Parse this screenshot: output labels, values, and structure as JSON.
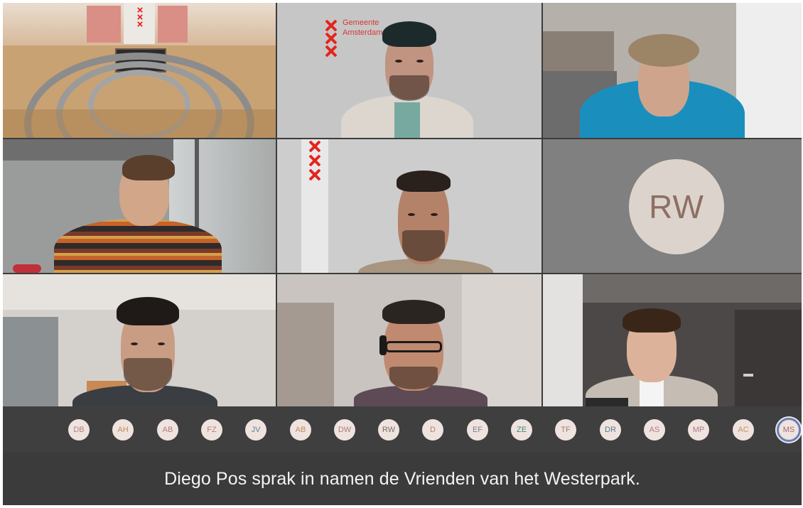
{
  "meeting": {
    "participants_visible": 9
  },
  "tiles": {
    "council_chamber": {
      "label": "council-chamber-feed"
    },
    "speaker_top_center": {
      "logo_line1": "Gemeente",
      "logo_line2": "Amsterdam"
    },
    "rw": {
      "initials": "RW"
    }
  },
  "participant_strip": {
    "chips": [
      {
        "initials": "DB",
        "color": "#b0807d"
      },
      {
        "initials": "AH",
        "color": "#c48a5c"
      },
      {
        "initials": "AB",
        "color": "#b77a80"
      },
      {
        "initials": "FZ",
        "color": "#b8807c"
      },
      {
        "initials": "JV",
        "color": "#5c8394"
      },
      {
        "initials": "AB",
        "color": "#c48a5c"
      },
      {
        "initials": "DW",
        "color": "#b07a7c"
      },
      {
        "initials": "RW",
        "color": "#7e6d66"
      },
      {
        "initials": "D",
        "color": "#c0786f"
      },
      {
        "initials": "EF",
        "color": "#7d7f8c"
      },
      {
        "initials": "ZE",
        "color": "#3f8a74"
      },
      {
        "initials": "TF",
        "color": "#9a7f74"
      },
      {
        "initials": "DR",
        "color": "#527d8c"
      },
      {
        "initials": "AS",
        "color": "#b5788a"
      },
      {
        "initials": "MP",
        "color": "#aa7a84"
      },
      {
        "initials": "AC",
        "color": "#c2945c"
      },
      {
        "initials": "MS",
        "color": "#a86b72"
      }
    ]
  },
  "caption": {
    "text": "Diego Pos sprak in namen de Vrienden van het Westerpark."
  },
  "colors": {
    "amsterdam_red": "#e4241d",
    "strip_bg": "#3f3f3f",
    "caption_bg": "#3b3b3b",
    "active_speaker_ring": "#6a7fb0"
  }
}
